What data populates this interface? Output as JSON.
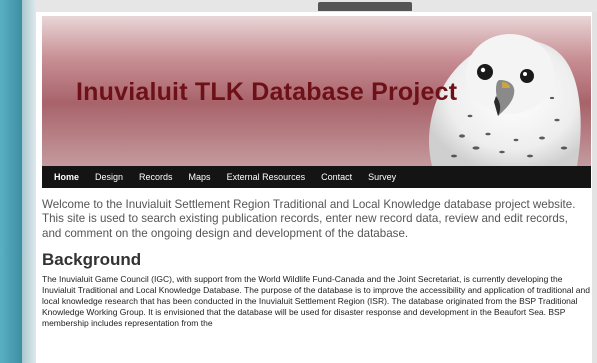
{
  "banner": {
    "title": "Inuvialuit TLK Database Project"
  },
  "nav": {
    "items": [
      {
        "label": "Home"
      },
      {
        "label": "Design"
      },
      {
        "label": "Records"
      },
      {
        "label": "Maps"
      },
      {
        "label": "External Resources"
      },
      {
        "label": "Contact"
      },
      {
        "label": "Survey"
      }
    ]
  },
  "content": {
    "intro": "Welcome to the Inuvialuit Settlement Region Traditional and Local Knowledge database project website. This site is used to search existing publication records, enter new record data, review and edit records, and comment on the ongoing design and development of the database.",
    "heading": "Background",
    "body": "The Inuvialuit Game Council (IGC), with support from the World Wildlife Fund-Canada and the Joint Secretariat, is currently developing the Inuvialuit Traditional and Local Knowledge Database. The purpose of the database is to improve the accessibility and application of traditional and local knowledge research that has been conducted in the Inuvialuit Settlement Region (ISR). The database originated from the BSP Traditional Knowledge Working Group. It is envisioned that the database will be used for disaster response and development in the Beaufort Sea. BSP membership includes representation from the"
  },
  "icons": {
    "banner_image": "gyrfalcon-image"
  }
}
